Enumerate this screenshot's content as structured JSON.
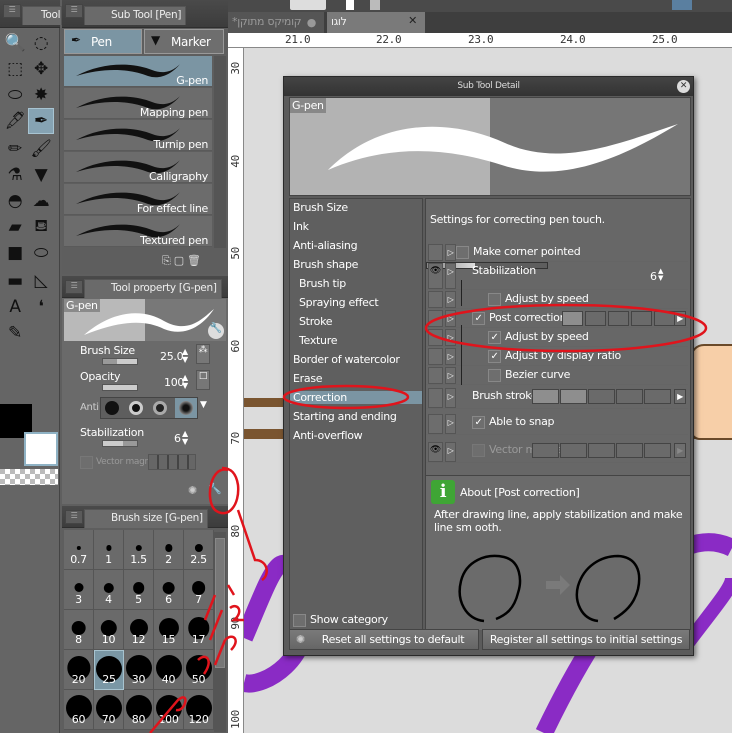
{
  "toolbox": {
    "tab_label": "Tool",
    "tools": [
      "zoom-icon",
      "rotate-icon",
      "object-icon",
      "move-layer-icon",
      "lasso-icon",
      "magic-wand-icon",
      "eyedropper-icon",
      "pen-icon",
      "pencil-icon",
      "brush-icon",
      "airbrush-icon",
      "marker-icon",
      "blend-icon",
      "decoration-icon",
      "eraser-icon",
      "fill-icon",
      "gradient-icon",
      "figure-icon",
      "frame-icon",
      "ruler-icon",
      "text-icon",
      "balloon-icon",
      "correct-line-icon"
    ]
  },
  "subtool": {
    "tab_label": "Sub Tool [Pen]",
    "groups": [
      "Pen",
      "Marker"
    ],
    "items": [
      "G-pen",
      "Mapping pen",
      "Turnip pen",
      "Calligraphy",
      "For effect line",
      "Textured pen"
    ],
    "selected": "G-pen"
  },
  "tool_property": {
    "tab_label": "Tool property [G-pen]",
    "preview_label": "G-pen",
    "brush_size_label": "Brush Size",
    "brush_size": "25.0",
    "brush_size_fraction": 0.4,
    "opacity_label": "Opacity",
    "opacity": "100",
    "opacity_fraction": 1.0,
    "anti_label": "Anti",
    "stabilization_label": "Stabilization",
    "stabilization": "6",
    "stabilization_fraction": 0.4,
    "vector_magnet_label": "Vector magn"
  },
  "brush_size": {
    "tab_label": "Brush size [G-pen]",
    "sizes": [
      "0.7",
      "1",
      "1.5",
      "2",
      "2.5",
      "3",
      "4",
      "5",
      "6",
      "7",
      "8",
      "10",
      "12",
      "15",
      "17",
      "20",
      "25",
      "30",
      "40",
      "50",
      "60",
      "70",
      "80",
      "100",
      "120"
    ],
    "selected": "25"
  },
  "document_tabs": [
    {
      "label": "*קומיקס מתוקן",
      "modified": true
    },
    {
      "label": "לוגו",
      "active": true
    }
  ],
  "ruler": {
    "h": [
      "21.0",
      "22.0",
      "23.0",
      "24.0",
      "25.0"
    ],
    "v": [
      "30",
      "40",
      "50",
      "60",
      "70",
      "80",
      "90",
      "100"
    ]
  },
  "dialog": {
    "title": "Sub Tool Detail",
    "preview_label": "G-pen",
    "categories": [
      "Brush Size",
      "Ink",
      "Anti-aliasing",
      "Brush shape",
      "Brush tip",
      "Spraying effect",
      "Stroke",
      "Texture",
      "Border of watercolor",
      "Erase",
      "Correction",
      "Starting and ending",
      "Anti-overflow"
    ],
    "selected_category": "Correction",
    "description": "Settings for correcting pen touch.",
    "settings": {
      "make_corner_pointed": "Make corner pointed",
      "stabilization": "Stabilization",
      "stabilization_value": "6",
      "stabilization_fraction": 0.4,
      "adjust_by_speed_1": "Adjust by speed",
      "post_correction": "Post correction",
      "post_correction_level": 1,
      "adjust_by_speed_2": "Adjust by speed",
      "adjust_by_display_ratio": "Adjust by display ratio",
      "bezier_curve": "Bezier curve",
      "brush_stroke": "Brush stroke",
      "brush_stroke_level": 2,
      "able_to_snap": "Able to snap",
      "vector_magnet": "Vector magnet"
    },
    "about_title": "About [Post correction]",
    "about_text": "After drawing line, apply stabilization and make line sm ooth.",
    "show_category": "Show category",
    "reset_button": "Reset all settings to default",
    "register_button": "Register all settings to initial settings"
  },
  "colors": {
    "annotation": "#e0141c",
    "accent_selected": "#7b95a3",
    "canvas_purple": "#8a2bc5",
    "info_green": "#3fa535"
  }
}
